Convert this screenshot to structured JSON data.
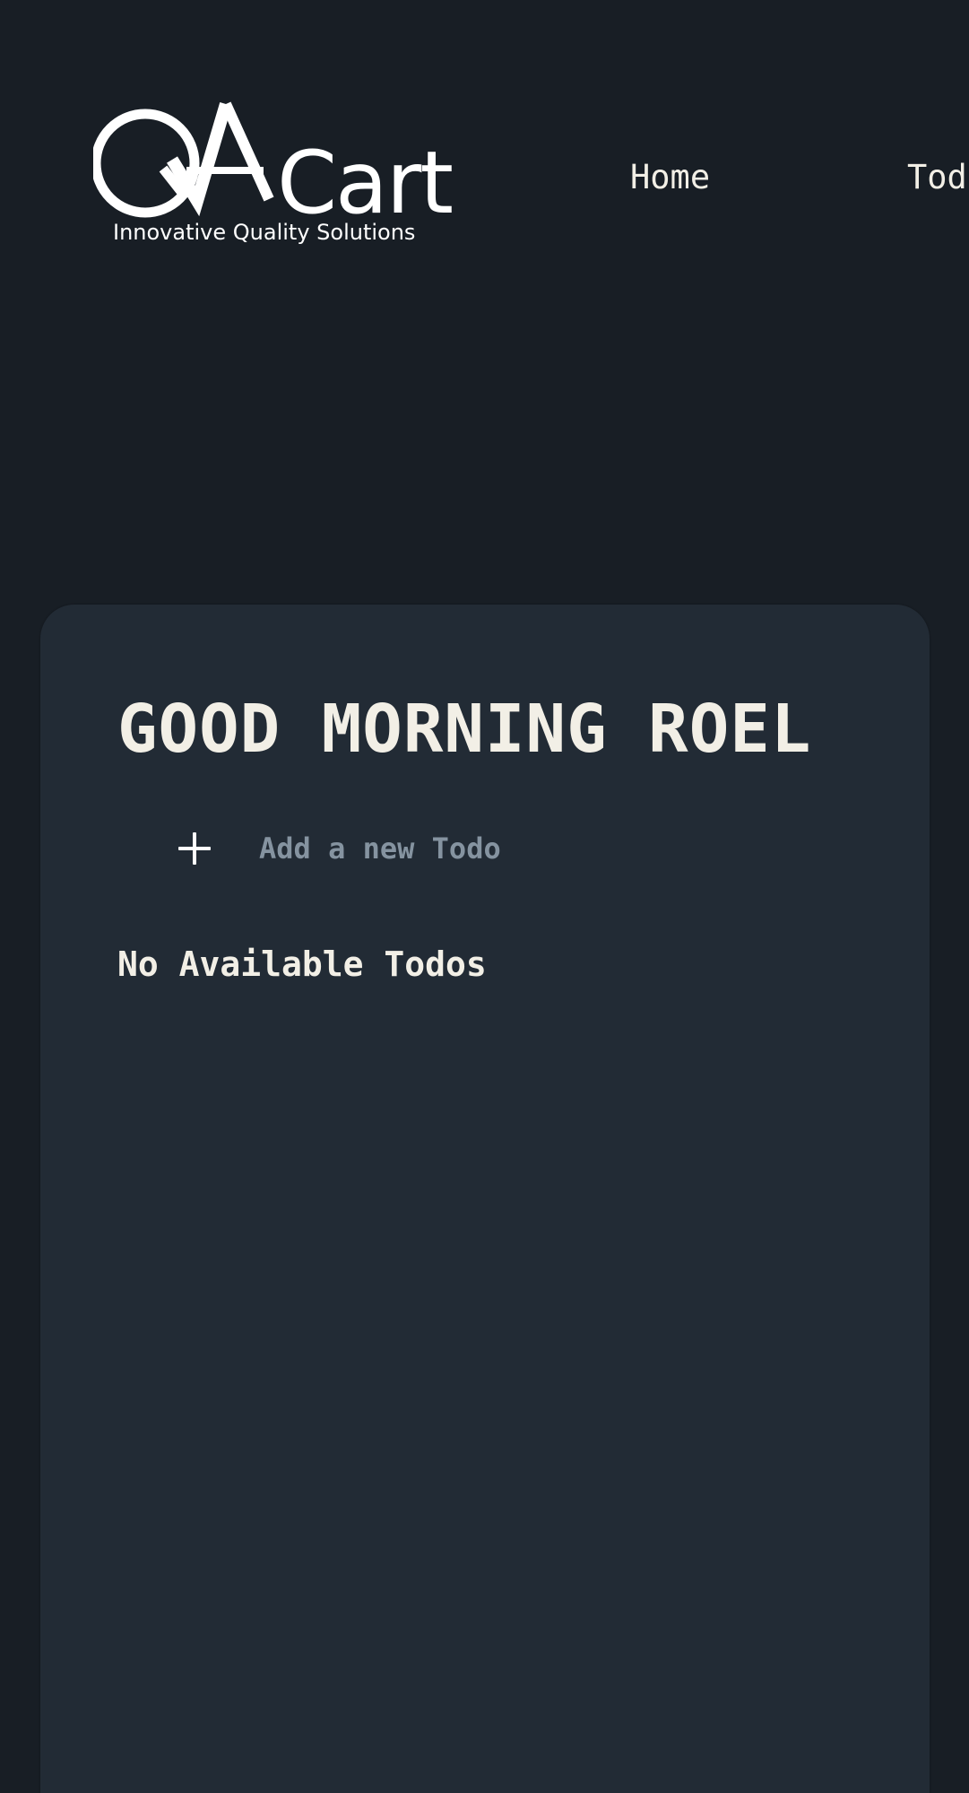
{
  "header": {
    "logo": {
      "wordmark": "Cart",
      "monogram": "QA",
      "tagline": "Innovative Quality Solutions"
    },
    "nav": [
      {
        "label": "Home"
      },
      {
        "label": "Todos"
      }
    ]
  },
  "main": {
    "greeting": "GOOD MORNING ROEL",
    "new_todo": {
      "icon": "plus-icon",
      "placeholder": "Add a new Todo",
      "value": ""
    },
    "empty_message": "No Available Todos"
  },
  "colors": {
    "page_background": "#181e25",
    "card_background": "#222b35",
    "text": "#f2efe6",
    "placeholder": "#8593a0",
    "logo": "#ffffff"
  }
}
